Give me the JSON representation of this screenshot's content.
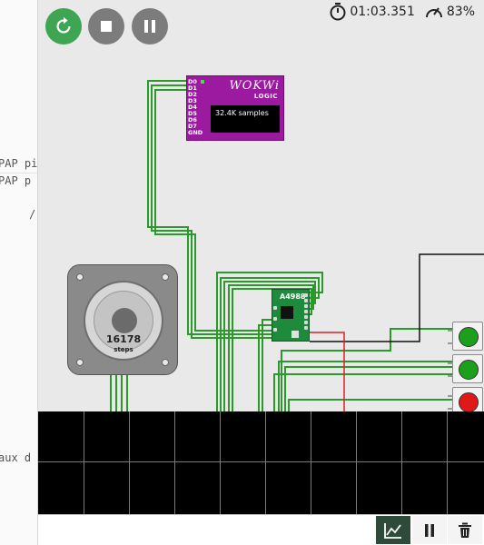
{
  "code": {
    "lines": [
      "PAP pi",
      "PAP p",
      "/",
      "aux d"
    ]
  },
  "controls": {
    "restart_icon": "restart-icon",
    "stop_icon": "stop-icon",
    "pause_icon": "pause-icon"
  },
  "status": {
    "time": "01:03.351",
    "speed": "83%",
    "timer_icon": "stopwatch-icon",
    "speed_icon": "gauge-icon"
  },
  "logic_analyzer": {
    "brand": "WOKWi",
    "subtitle": "LOGIC",
    "samples": "32.4K samples",
    "pins": [
      "D0",
      "D1",
      "D2",
      "D3",
      "D4",
      "D5",
      "D6",
      "D7",
      "GND"
    ]
  },
  "stepper": {
    "steps": "16178",
    "steps_label": "steps"
  },
  "driver": {
    "name": "A4988"
  },
  "buttons": [
    {
      "color": "#1ca01c"
    },
    {
      "color": "#1ca01c"
    },
    {
      "color": "#e01818"
    }
  ],
  "toolbar": {
    "chart_icon": "chart-icon",
    "pause_icon": "pause-icon",
    "clear_icon": "trash-icon"
  },
  "colors": {
    "accent_green": "#3ea552",
    "wire_green": "#2a9a2a",
    "wire_red": "#e02020",
    "wire_black": "#111111",
    "logic_purple": "#9b1aa0"
  }
}
